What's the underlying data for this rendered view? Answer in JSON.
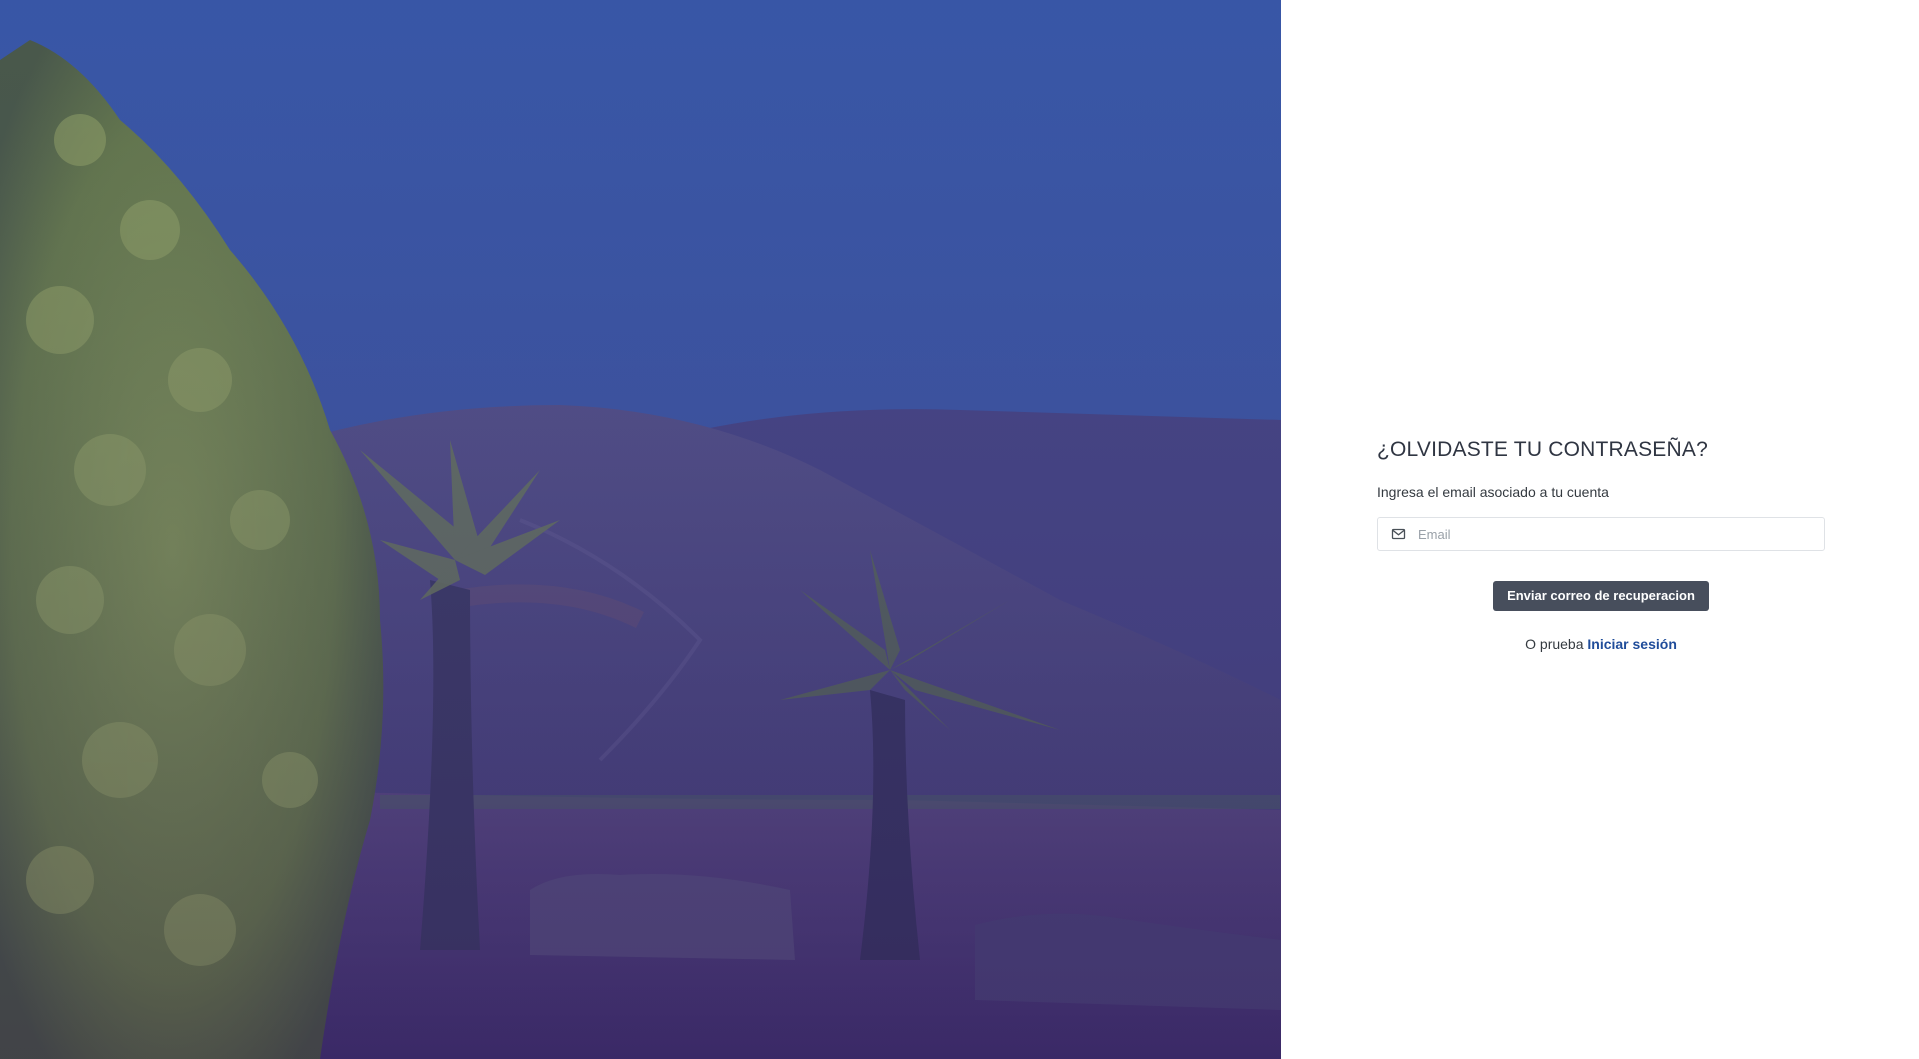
{
  "hero": {
    "image_icon": "landscape-photo"
  },
  "form": {
    "title": "¿OLVIDASTE TU CONTRASEÑA?",
    "subtitle": "Ingresa el email asociado a tu cuenta",
    "email": {
      "icon": "mail-icon",
      "value": "",
      "placeholder": "Email"
    },
    "submit_label": "Enviar correo de recuperacion",
    "alt_prefix": "O prueba",
    "login_link_label": "Iniciar sesión"
  },
  "colors": {
    "button_bg": "#474e5c",
    "link": "#1f4c9a",
    "overlay_top": "#3a5aa8",
    "overlay_bottom": "#3c2f6e"
  }
}
